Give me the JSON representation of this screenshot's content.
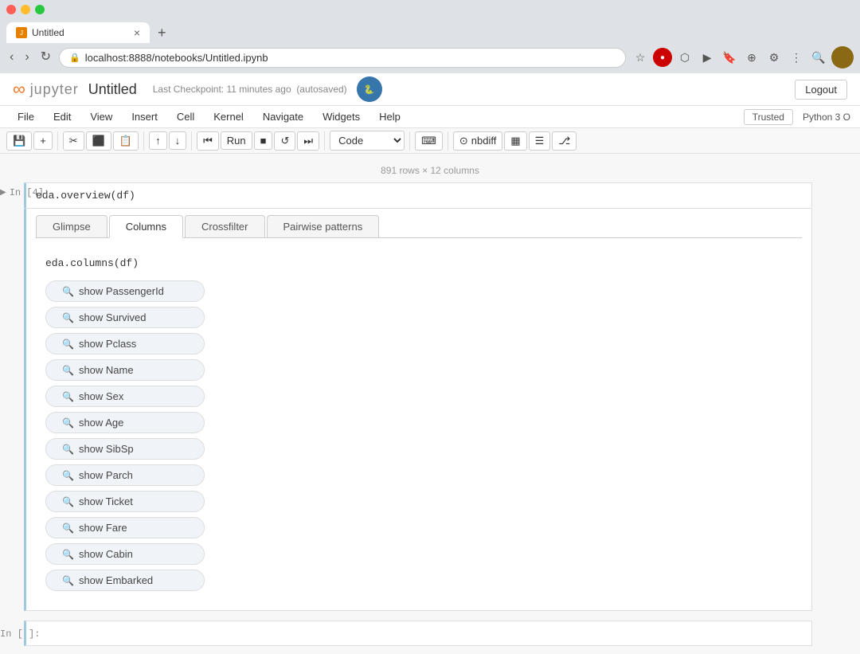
{
  "browser": {
    "tab_title": "Untitled",
    "tab_url": "localhost:8888/notebooks/Untitled.ipynb",
    "new_tab_label": "+",
    "back_disabled": false,
    "forward_disabled": true
  },
  "jupyter": {
    "logo_text": "jupyter",
    "notebook_title": "Untitled",
    "checkpoint_text": "Last Checkpoint: 11 minutes ago",
    "autosaved_text": "(autosaved)",
    "logout_label": "Logout",
    "python_badge": "🐍"
  },
  "menu": {
    "items": [
      "File",
      "Edit",
      "View",
      "Insert",
      "Cell",
      "Kernel",
      "Navigate",
      "Widgets",
      "Help"
    ],
    "trusted_label": "Trusted",
    "python_label": "Python 3 O"
  },
  "toolbar": {
    "save_icon": "💾",
    "add_icon": "+",
    "cut_icon": "✂",
    "copy_icon": "📋",
    "paste_icon": "📋",
    "move_up_icon": "↑",
    "move_down_icon": "↓",
    "step_back_icon": "⏮",
    "run_label": "Run",
    "stop_icon": "■",
    "restart_icon": "↺",
    "fast_forward_icon": "⏭",
    "code_select_value": "Code",
    "keyboard_icon": "⌨",
    "nbdiff_label": "nbdiff",
    "chart_icon": "▦",
    "list_icon": "☰",
    "share_icon": "⎇"
  },
  "info_bar": {
    "text": "891 rows × 12 columns"
  },
  "cell": {
    "execution_count": "4",
    "code": "eda.overview(df)",
    "tabs": [
      {
        "label": "Glimpse",
        "active": false
      },
      {
        "label": "Columns",
        "active": true
      },
      {
        "label": "Crossfilter",
        "active": false
      },
      {
        "label": "Pairwise patterns",
        "active": false
      }
    ],
    "eda_code": "eda.columns(df)",
    "columns": [
      {
        "label": "show PassengerId"
      },
      {
        "label": "show Survived"
      },
      {
        "label": "show Pclass"
      },
      {
        "label": "show Name"
      },
      {
        "label": "show Sex"
      },
      {
        "label": "show Age"
      },
      {
        "label": "show SibSp"
      },
      {
        "label": "show Parch"
      },
      {
        "label": "show Ticket"
      },
      {
        "label": "show Fare"
      },
      {
        "label": "show Cabin"
      },
      {
        "label": "show Embarked"
      }
    ]
  },
  "empty_cell": {
    "label": "In [ ]:"
  }
}
